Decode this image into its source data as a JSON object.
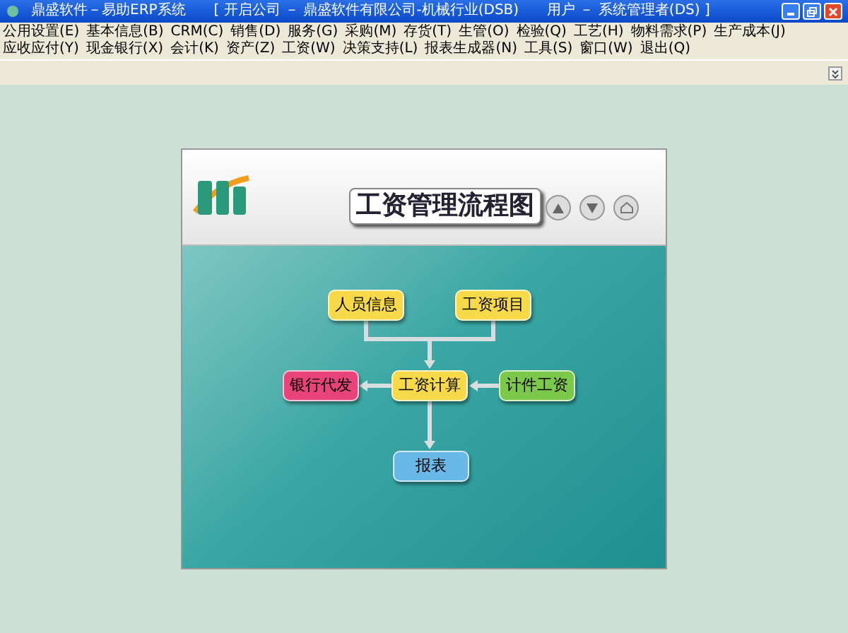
{
  "window": {
    "title": "鼎盛软件－易助ERP系统",
    "company": "[ 开启公司 － 鼎盛软件有限公司-机械行业(DSB)",
    "user": "用户 － 系统管理者(DS) ]"
  },
  "menu": [
    "公用设置(E)",
    "基本信息(B)",
    "CRM(C)",
    "销售(D)",
    "服务(G)",
    "采购(M)",
    "存货(T)",
    "生管(O)",
    "检验(Q)",
    "工艺(H)",
    "物料需求(P)",
    "生产成本(J)",
    "应收应付(Y)",
    "现金银行(X)",
    "会计(K)",
    "资产(Z)",
    "工资(W)",
    "决策支持(L)",
    "报表生成器(N)",
    "工具(S)",
    "窗口(W)",
    "退出(Q)"
  ],
  "diagram": {
    "title": "工资管理流程图",
    "nodes": [
      {
        "label": "人员信息",
        "color": "#f7d94a"
      },
      {
        "label": "工资项目",
        "color": "#f7d94a"
      },
      {
        "label": "银行代发",
        "color": "#e8437a"
      },
      {
        "label": "工资计算",
        "color": "#f7d94a"
      },
      {
        "label": "计件工资",
        "color": "#7cc84a"
      },
      {
        "label": "报表",
        "color": "#6ab8e8"
      }
    ]
  }
}
